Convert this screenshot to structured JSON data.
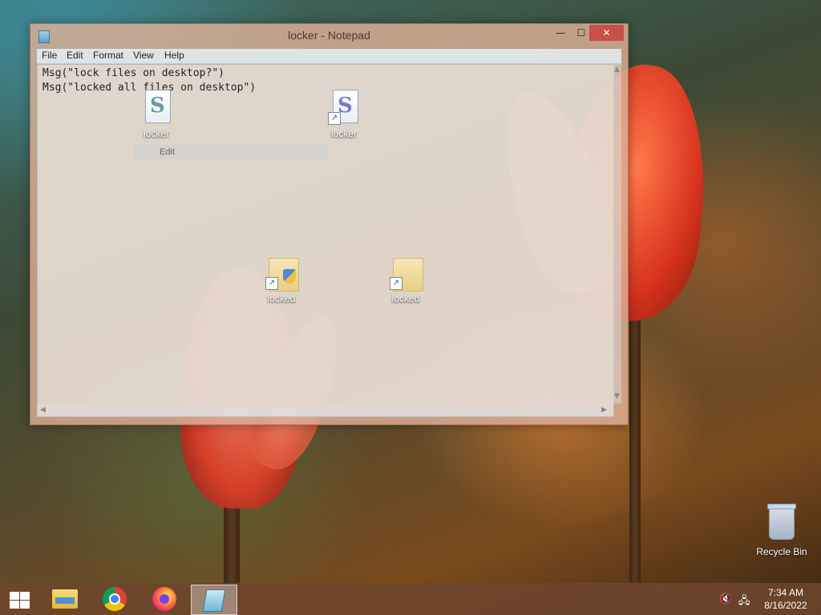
{
  "notepad": {
    "title": "locker - Notepad",
    "window_controls": {
      "minimize": "—",
      "maximize": "☐",
      "close": "✕"
    },
    "menu": [
      "File",
      "Edit",
      "Format",
      "View",
      "Help"
    ],
    "content_lines": [
      "Msg(\"lock files on desktop?\")",
      "Msg(\"locked all files on desktop\")"
    ]
  },
  "desktop": {
    "icons": [
      {
        "label": "locker",
        "icon": "vbscript-file-icon"
      },
      {
        "label": "locker",
        "icon": "vbscript-shortcut-icon"
      },
      {
        "label": "locked",
        "icon": "folder-shortcut-icon"
      },
      {
        "label": "locked",
        "icon": "folder-shortcut-icon"
      }
    ],
    "edit_strip_label": "Edit",
    "recycle_bin": "Recycle Bin"
  },
  "taskbar": {
    "items": [
      {
        "icon": "windows-start-icon"
      },
      {
        "icon": "file-explorer-icon"
      },
      {
        "icon": "chrome-icon"
      },
      {
        "icon": "firefox-icon"
      },
      {
        "icon": "notepad-icon",
        "active": true
      }
    ],
    "tray": {
      "volume_icon": "muted-speaker-icon",
      "network_icon": "network-icon"
    },
    "clock": {
      "time": "7:34 AM",
      "date": "8/16/2022"
    }
  },
  "colors": {
    "close_button": "#c7504a",
    "taskbar": "#6e462d"
  }
}
